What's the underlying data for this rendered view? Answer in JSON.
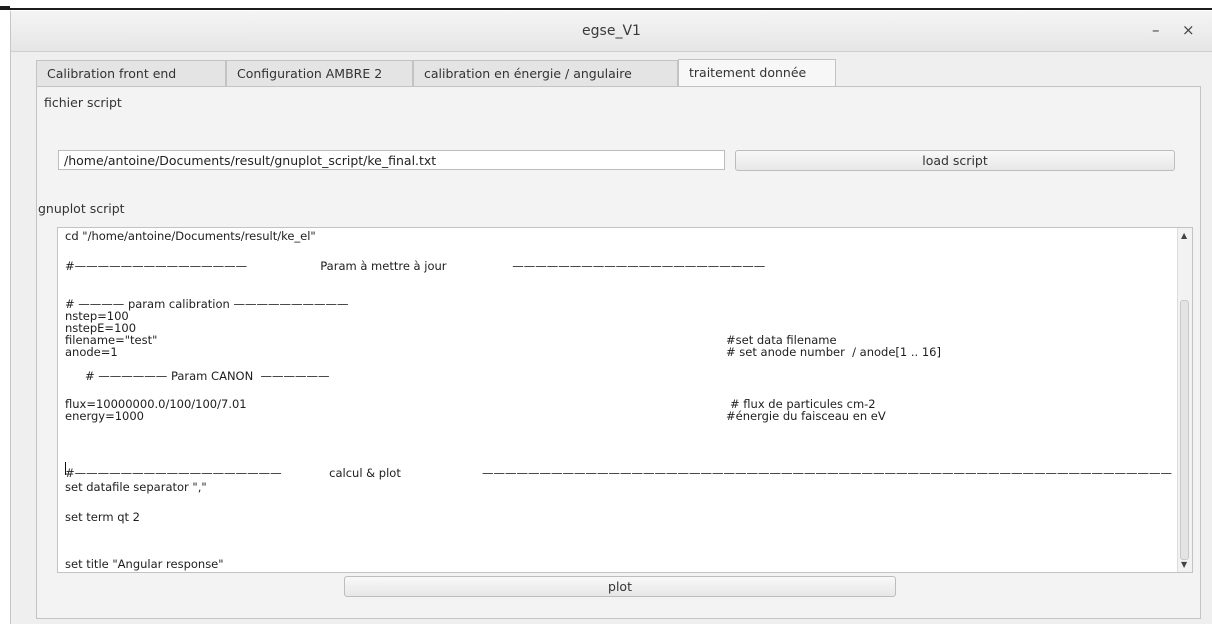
{
  "window": {
    "title": "egse_V1",
    "minimize_glyph": "–",
    "close_glyph": "×"
  },
  "tabs": [
    {
      "label": "Calibration front end"
    },
    {
      "label": "Configuration AMBRE 2"
    },
    {
      "label": "calibration en énergie / angulaire"
    },
    {
      "label": "traitement donnée"
    }
  ],
  "active_tab": "traitement donnée",
  "script_file": {
    "label": "fichier script",
    "path_value": "/home/antoine/Documents/result/gnuplot_script/ke_final.txt",
    "load_button": "load script"
  },
  "gnuplot": {
    "label": "gnuplot script",
    "lines": [
      "cd \"/home/antoine/Documents/result/ke_el\"",
      "#———————————————                    Param à mettre à jour                  ——————————————————————",
      "# ———— param calibration ——————————",
      "nstep=100",
      "nstepE=100",
      "filename=\"test\"",
      "anode=1",
      "#set data filename",
      "# set anode number  / anode[1 .. 16]",
      "# —————— Param CANON  ——————",
      "flux=10000000.0/100/100/7.01",
      "energy=1000",
      "# flux de particules cm-2",
      "#énergie du faisceau en eV",
      "#——————————————————             calcul & plot",
      "————————————————————————————————————————————————————————————",
      "set datafile separator \",\"",
      "set term qt 2",
      "set title \"Angular response\""
    ]
  },
  "plot_button": "plot",
  "scrollbar": {
    "up_icon": "▲",
    "down_icon": "▼"
  }
}
